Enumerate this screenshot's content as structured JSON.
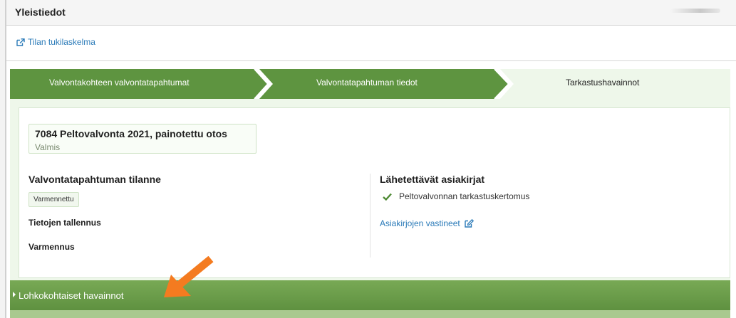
{
  "header": {
    "title": "Yleistiedot"
  },
  "link_row": {
    "link_label": "Tilan tukilaskelma"
  },
  "steps": [
    {
      "label": "Valvontakohteen valvontatapahtumat",
      "state": "completed"
    },
    {
      "label": "Valvontatapahtuman tiedot",
      "state": "completed"
    },
    {
      "label": "Tarkastushavainnot",
      "state": "current"
    }
  ],
  "case": {
    "title": "7084 Peltovalvonta 2021, painotettu otos",
    "status": "Valmis"
  },
  "left": {
    "heading": "Valvontatapahtuman tilanne",
    "badge": "Varmennettu",
    "saving_label": "Tietojen tallennus",
    "verification_label": "Varmennus"
  },
  "right": {
    "heading": "Lähetettävät asiakirjat",
    "document": "Peltovalvonnan tarkastuskertomus",
    "responses_link": "Asiakirjojen vastineet"
  },
  "accordion": {
    "label": "Lohkokohtaiset havainnot"
  },
  "colors": {
    "step_done": "#5e9440",
    "step_current": "#eef7ea",
    "accordion": "#6a9c4b",
    "link": "#2a7ab8",
    "pointer_arrow": "#f47b20"
  },
  "icons": {
    "link": "external-link-icon",
    "check": "check-icon",
    "edit": "edit-icon",
    "caret": "caret-right-icon",
    "annotation": "pointer-arrow-icon"
  }
}
